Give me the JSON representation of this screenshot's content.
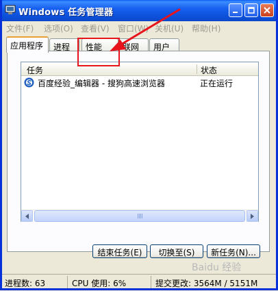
{
  "window": {
    "title": "Windows 任务管理器"
  },
  "menu": [
    "文件(F)",
    "选项(O)",
    "查看(V)",
    "窗口(W)",
    "关机(U)",
    "帮助(H)"
  ],
  "tabs": [
    "应用程序",
    "进程",
    "性能",
    "联网",
    "用户"
  ],
  "active_tab": "应用程序",
  "list": {
    "columns": [
      "任务",
      "状态"
    ],
    "rows": [
      {
        "task": "百度经验_编辑器 - 搜狗高速浏览器",
        "status": "正在运行",
        "icon": "sogou-browser-icon"
      }
    ]
  },
  "buttons": {
    "end_task": "结束任务(E)",
    "switch_to": "切换至(S)",
    "new_task": "新任务(N)..."
  },
  "status": {
    "processes": "进程数: 63",
    "cpu": "CPU 使用: 6%",
    "commit": "提交更改: 3564M / 5151M"
  },
  "watermark": "Baidu 经验",
  "colors": {
    "titlebar": "#0b4fd8",
    "annotation": "#e8141c",
    "tab_highlight": "#e8a036"
  }
}
